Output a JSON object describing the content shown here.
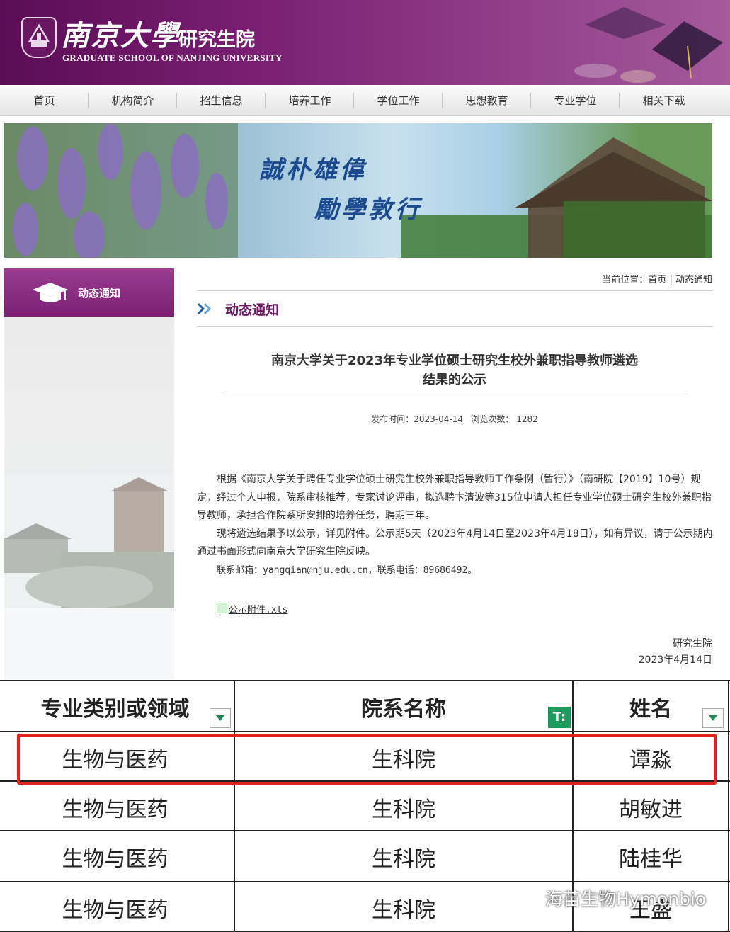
{
  "header": {
    "brand_cn": "南京大學",
    "school_cn": "研究生院",
    "school_en": "GRADUATE SCHOOL OF NANJING UNIVERSITY"
  },
  "nav": [
    "首页",
    "机构简介",
    "招生信息",
    "培养工作",
    "学位工作",
    "思想教育",
    "专业学位",
    "相关下载"
  ],
  "banner": {
    "motto_line1": "誠朴雄偉",
    "motto_line2": "勵學敦行"
  },
  "sidebar": {
    "tab_label": "动态通知"
  },
  "breadcrumb": {
    "prefix": "当前位置：",
    "home": "首页",
    "sep": "|",
    "current": "动态通知"
  },
  "section": {
    "title": "动态通知"
  },
  "article": {
    "title_line1": "南京大学关于2023年专业学位硕士研究生校外兼职指导教师遴选",
    "title_line2": "结果的公示",
    "meta": "发布时间：2023-04-14   浏览次数： 1282",
    "para1": "根据《南京大学关于聘任专业学位硕士研究生校外兼职指导教师工作条例（暂行）》（南研院【2019】10号）规定，经过个人申报，院系审核推荐，专家讨论评审，拟选聘卞清波等315位申请人担任专业学位硕士研究生校外兼职指导教师，承担合作院系所安排的培养任务，聘期三年。",
    "para2": "现将遴选结果予以公示，详见附件。公示期5天（2023年4月14日至2023年4月18日），如有异议，请于公示期内通过书面形式向南京大学研究生院反映。",
    "para3": "联系邮箱：yangqian@nju.edu.cn，联系电话：89686492。",
    "attachment": "公示附件.xls",
    "signer": "研究生院",
    "date": "2023年4月14日"
  },
  "table": {
    "headers": [
      "专业类别或领域",
      "院系名称",
      "姓名"
    ],
    "filter_icon_text": "T:",
    "rows": [
      [
        "生物与医药",
        "生科院",
        "谭淼"
      ],
      [
        "生物与医药",
        "生科院",
        "胡敏进"
      ],
      [
        "生物与医药",
        "生科院",
        "陆桂华"
      ],
      [
        "生物与医药",
        "生科院",
        "王盛"
      ]
    ]
  },
  "watermark": "海苗生物Hymonbio",
  "colors": {
    "brand_purple": "#7a1f73",
    "highlight_red": "#e0231c",
    "filter_green": "#1f9a5f"
  }
}
